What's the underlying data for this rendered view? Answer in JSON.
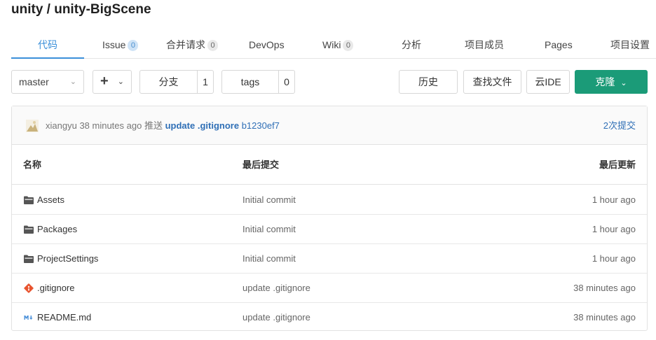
{
  "repo": {
    "title": "unity / unity-BigScene"
  },
  "tabs": [
    {
      "label": "代码",
      "badge": null
    },
    {
      "label": "Issue",
      "badge": "0"
    },
    {
      "label": "合并请求",
      "badge": "0"
    },
    {
      "label": "DevOps",
      "badge": null
    },
    {
      "label": "Wiki",
      "badge": "0"
    },
    {
      "label": "分析",
      "badge": null
    },
    {
      "label": "项目成员",
      "badge": null
    },
    {
      "label": "Pages",
      "badge": null
    },
    {
      "label": "项目设置",
      "badge": null
    }
  ],
  "toolbar": {
    "branch": "master",
    "plus": "+",
    "branches_label": "分支",
    "branches_count": "1",
    "tags_label": "tags",
    "tags_count": "0",
    "history": "历史",
    "find_file": "查找文件",
    "cloud_ide": "云IDE",
    "clone": "克隆"
  },
  "last_commit": {
    "author": "xiangyu",
    "time": "38 minutes ago",
    "action": "推送",
    "message": "update .gitignore",
    "sha": "b1230ef7",
    "count": "2次提交"
  },
  "table": {
    "headers": {
      "name": "名称",
      "commit": "最后提交",
      "updated": "最后更新"
    },
    "rows": [
      {
        "icon": "folder-icon",
        "name": "Assets",
        "commit": "Initial commit",
        "time": "1 hour ago"
      },
      {
        "icon": "folder-icon",
        "name": "Packages",
        "commit": "Initial commit",
        "time": "1 hour ago"
      },
      {
        "icon": "folder-icon",
        "name": "ProjectSettings",
        "commit": "Initial commit",
        "time": "1 hour ago"
      },
      {
        "icon": "git-icon",
        "name": ".gitignore",
        "commit": "update .gitignore",
        "time": "38 minutes ago"
      },
      {
        "icon": "markdown-icon",
        "name": "README.md",
        "commit": "update .gitignore",
        "time": "38 minutes ago"
      }
    ]
  },
  "colors": {
    "accent": "#3b8fd9",
    "clone": "#1b9b78",
    "link": "#2f6fb6",
    "git": "#e8542f"
  }
}
